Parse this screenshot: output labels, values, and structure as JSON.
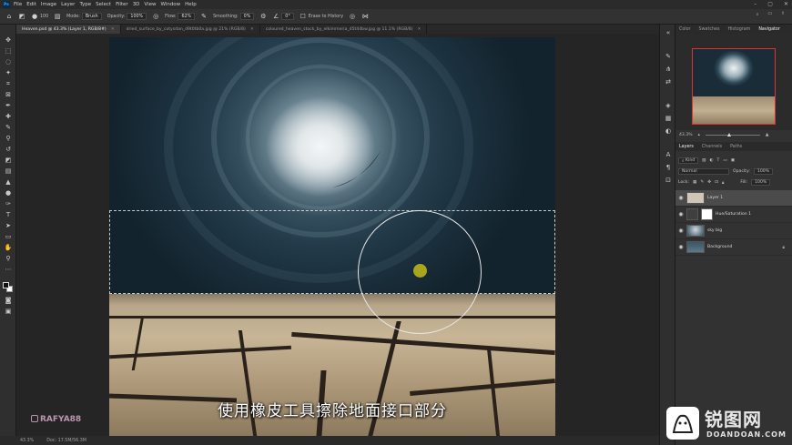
{
  "app": {
    "logo_text": "Ps"
  },
  "menu": [
    "File",
    "Edit",
    "Image",
    "Layer",
    "Type",
    "Select",
    "Filter",
    "3D",
    "View",
    "Window",
    "Help"
  ],
  "options": {
    "brush_size": "100",
    "mode_label": "Mode:",
    "mode_value": "Brush",
    "opacity_label": "Opacity:",
    "opacity_value": "100%",
    "flow_label": "Flow:",
    "flow_value": "62%",
    "smoothing_label": "Smoothing:",
    "smoothing_value": "0%",
    "angle_value": "0°",
    "erase_history_label": "Erase to History"
  },
  "tabs": [
    {
      "label": "Heaven.psd @ 43.3% (Layer 1, RGB/8#)",
      "active": true
    },
    {
      "label": "dried_surface_by_cotysdan_d9t0tb0a.jpg @ 21% (RGB/8)",
      "active": false
    },
    {
      "label": "coloured_heaven_stock_by_elkimmeria_d5t44bw.jpg @ 11.1% (RGB/8)",
      "active": false
    }
  ],
  "canvas": {
    "caption": "使用橡皮工具擦除地面接口部分",
    "watermark": "RAFYA88"
  },
  "status": {
    "zoom": "43.3%",
    "doc": "Doc: 17.5M/56.3M"
  },
  "right_tabs": [
    "Color",
    "Swatches",
    "Histogram",
    "Navigator"
  ],
  "navigator": {
    "zoom": "43.3%"
  },
  "layers_tabs": [
    "Layers",
    "Channels",
    "Paths"
  ],
  "layers_panel": {
    "filter_kind": "Kind",
    "blend_mode": "Normal",
    "opacity_label": "Opacity:",
    "opacity_value": "100%",
    "lock_label": "Lock:",
    "fill_label": "Fill:",
    "fill_value": "100%"
  },
  "layers": [
    {
      "name": "Layer 1",
      "selected": true,
      "thumb_color": "#cfc6b6"
    },
    {
      "name": "Hue/Saturation 1",
      "selected": false,
      "thumb_color": "#ffffff"
    },
    {
      "name": "sky big",
      "selected": false,
      "thumb_color": "#2e4a5a"
    },
    {
      "name": "Background",
      "selected": false,
      "thumb_color": "#3a5566"
    }
  ],
  "brand": {
    "name_cn": "锐图网",
    "name_en": "DOANDOAN.COM"
  },
  "colors": {
    "accent_red": "#e0312a",
    "selection_gold": "#b9b21a"
  }
}
